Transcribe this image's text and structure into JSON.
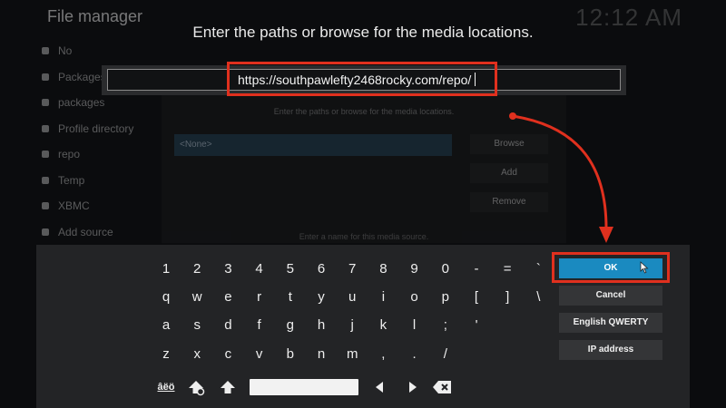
{
  "background": {
    "title": "File manager",
    "clock": "12:12 AM",
    "side_items": [
      "No",
      "Packages",
      "packages",
      "Profile directory",
      "repo",
      "Temp",
      "XBMC",
      "Add source"
    ],
    "inner_dialog": {
      "prompt": "Enter the paths or browse for the media locations.",
      "field_value": "<None>",
      "browse_label": "Browse",
      "add_label": "Add",
      "remove_label": "Remove",
      "footer": "Enter a name for this media source."
    }
  },
  "dialog": {
    "prompt": "Enter the paths or browse for the media locations.",
    "entry_value": "https://southpawlefty2468rocky.com/repo/"
  },
  "keyboard": {
    "rows": [
      [
        "1",
        "2",
        "3",
        "4",
        "5",
        "6",
        "7",
        "8",
        "9",
        "0",
        "-",
        "=",
        "`"
      ],
      [
        "q",
        "w",
        "e",
        "r",
        "t",
        "y",
        "u",
        "i",
        "o",
        "p",
        "[",
        "]",
        "\\"
      ],
      [
        "a",
        "s",
        "d",
        "f",
        "g",
        "h",
        "j",
        "k",
        "l",
        ";",
        "'"
      ],
      [
        "z",
        "x",
        "c",
        "v",
        "b",
        "n",
        "m",
        ",",
        ".",
        "/"
      ]
    ],
    "symbols_label": "âëö"
  },
  "buttons": {
    "ok": "OK",
    "cancel": "Cancel",
    "layout": "English QWERTY",
    "ip": "IP address"
  },
  "colors": {
    "accent": "#1a8ac0",
    "highlight": "#e0301e"
  }
}
